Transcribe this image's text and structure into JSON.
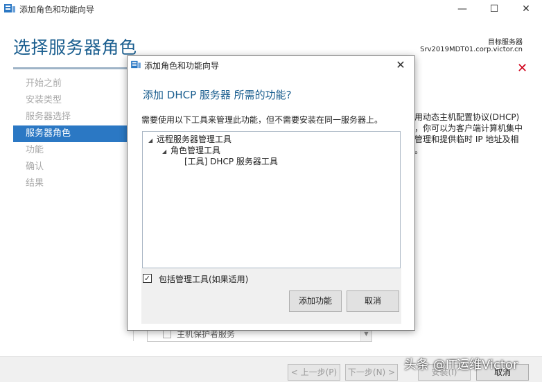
{
  "window": {
    "title": "添加角色和功能向导",
    "minimize": "—",
    "maximize": "☐",
    "close": "✕"
  },
  "header": {
    "page_title": "选择服务器角色",
    "target_label": "目标服务器",
    "target_value": "Srv2019MDT01.corp.victor.cn"
  },
  "nav": {
    "items": [
      {
        "label": "开始之前"
      },
      {
        "label": "安装类型"
      },
      {
        "label": "服务器选择"
      },
      {
        "label": "服务器角色"
      },
      {
        "label": "功能"
      },
      {
        "label": "确认"
      },
      {
        "label": "结果"
      }
    ]
  },
  "background": {
    "desc_lines": [
      "用动态主机配置协议(DHCP)",
      "，你可以为客户端计算机集中",
      "管理和提供临时 IP 地址及相",
      "。"
    ],
    "list_item": "主机保护者服务"
  },
  "dialog": {
    "title": "添加角色和功能向导",
    "close": "✕",
    "heading": "添加 DHCP 服务器 所需的功能?",
    "description": "需要使用以下工具来管理此功能，但不需要安装在同一服务器上。",
    "tree": [
      {
        "label": "远程服务器管理工具",
        "expanded": true
      },
      {
        "label": "角色管理工具",
        "expanded": true
      },
      {
        "label": "[工具] DHCP 服务器工具"
      }
    ],
    "checkbox_label": "包括管理工具(如果适用)",
    "checkbox_checked": true,
    "checkbox_mark": "✓",
    "add_button": "添加功能",
    "cancel_button": "取消"
  },
  "footer": {
    "prev": "< 上一步(P)",
    "next": "下一步(N) >",
    "install": "安装(I)",
    "cancel": "取消"
  },
  "watermark": "头条 @IT运维Victor",
  "colors": {
    "accent": "#2b78c4",
    "title_blue": "#1a5e8f",
    "close_red": "#d0021b"
  }
}
